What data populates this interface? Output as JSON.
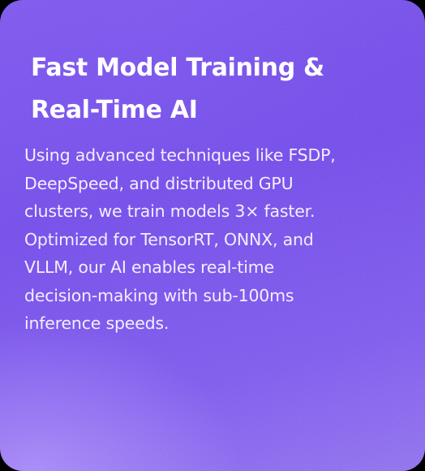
{
  "card": {
    "title_lines": [
      "Fast Model Training &",
      "Real-Time AI"
    ],
    "body_lines": [
      "Using advanced techniques like FSDP,",
      "DeepSpeed, and distributed GPU",
      "clusters, we train models 3× faster.",
      "Optimized for TensorRT, ONNX, and",
      "VLLM, our AI enables real-time",
      "decision-making with sub-100ms",
      "inference speeds."
    ]
  },
  "colors": {
    "card_background": "#7450ea",
    "title": "#ffffff",
    "body_text": "#f3eeff"
  }
}
